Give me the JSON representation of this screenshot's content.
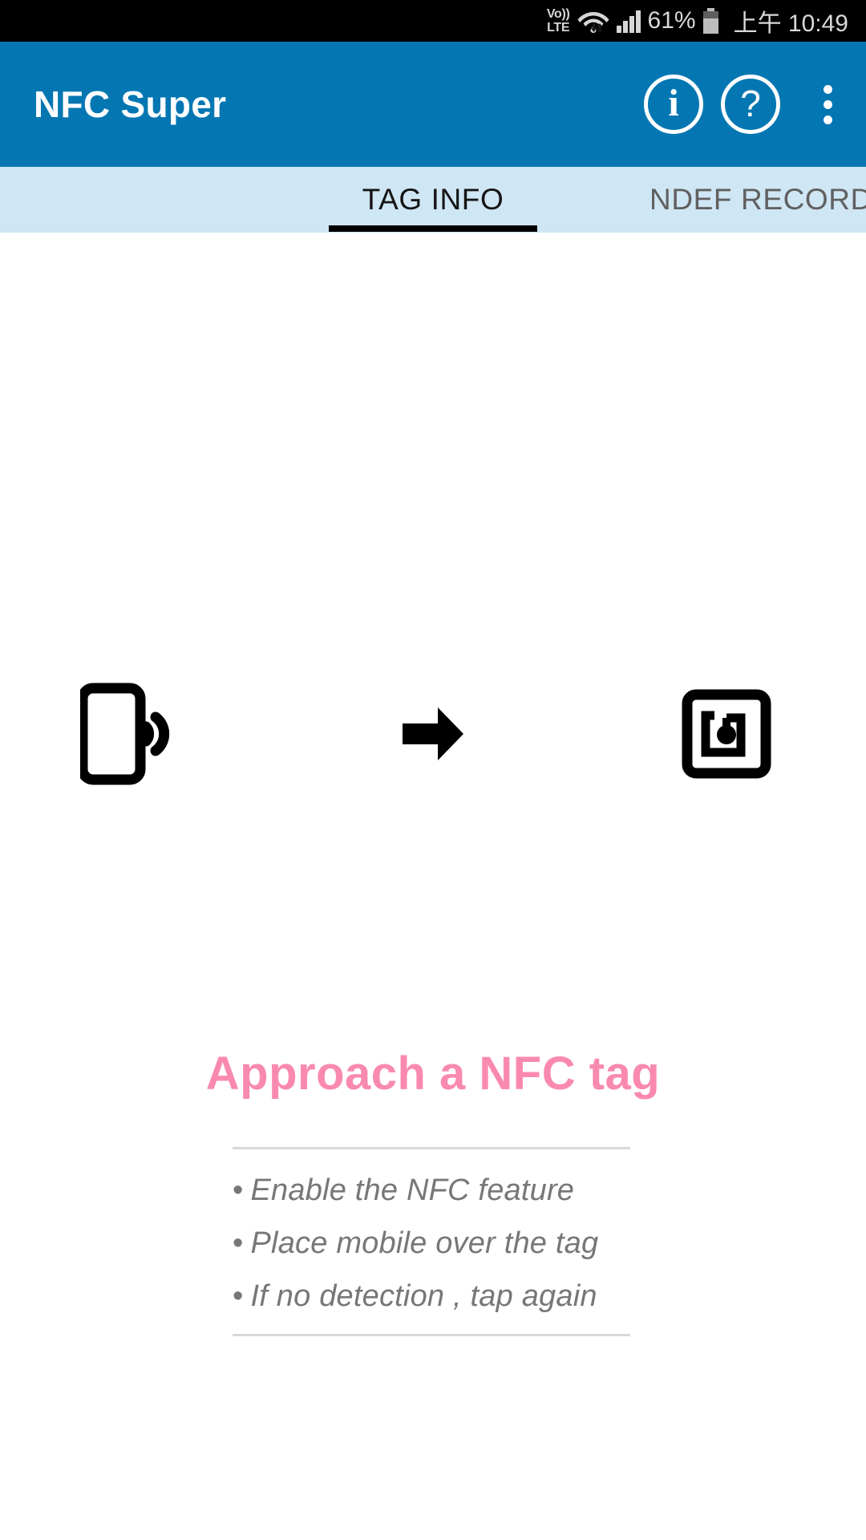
{
  "status_bar": {
    "volte_line1": "Vo))",
    "volte_line2": "LTE",
    "wifi_icon": "wifi-icon",
    "signal_icon": "cellular-signal-icon",
    "battery_percent": "61%",
    "battery_icon": "battery-icon",
    "time": "上午 10:49"
  },
  "app_bar": {
    "title": "NFC Super",
    "info_glyph": "i",
    "help_glyph": "?",
    "info_icon": "info-circle-icon",
    "help_icon": "help-circle-icon",
    "overflow_icon": "overflow-menu-icon"
  },
  "tabs": [
    {
      "label": "TAG INFO",
      "active": true
    },
    {
      "label": "NDEF RECORD",
      "active": false
    }
  ],
  "main": {
    "phone_icon": "phone-nfc-wave-icon",
    "arrow_icon": "arrow-right-icon",
    "tag_icon": "nfc-tag-icon",
    "headline": "Approach a NFC tag",
    "hints": [
      {
        "bullet": "•",
        "text": "Enable the NFC feature"
      },
      {
        "bullet": "•",
        "text": "Place mobile over the tag"
      },
      {
        "bullet": "•",
        "text": "If no detection , tap again"
      }
    ]
  },
  "colors": {
    "app_bar_blue": "#0477b3",
    "tab_bar_blue": "#cfe6f4",
    "headline_pink": "#f98aae",
    "hint_gray": "#777777",
    "status_bar_black": "#000000"
  }
}
